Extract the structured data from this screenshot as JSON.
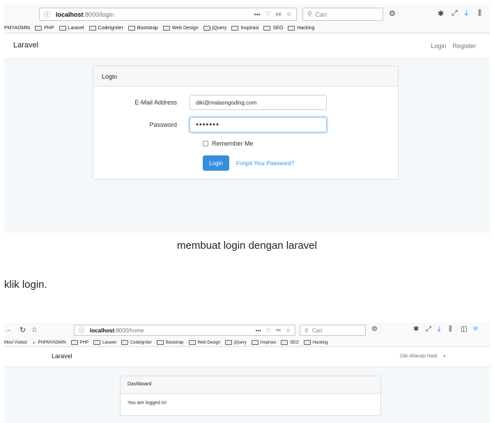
{
  "shot1": {
    "url": {
      "host": "localhost",
      "path": ":8000/login"
    },
    "url_actions": [
      "•••",
      "pocket-icon",
      "pip",
      "star-icon"
    ],
    "search_placeholder": "Cari",
    "bookmarks": [
      "PMYADMIN",
      "PHP",
      "Laravel",
      "CodeIgniter",
      "Bootstrap",
      "Web Design",
      "jQuery",
      "Inspirasi",
      "SEO",
      "Hacking"
    ],
    "navbar": {
      "brand": "Laravel",
      "login": "Login",
      "register": "Register"
    },
    "panel": {
      "heading": "Login",
      "email_label": "E-Mail Address",
      "email_value": "diki@malasngoding.com",
      "password_label": "Password",
      "password_value": "•••••••",
      "remember_label": "Remember Me",
      "login_button": "Login",
      "forgot_link": "Forgot Your Password?"
    }
  },
  "caption": "membuat login dengan laravel",
  "paragraph": "klik login.",
  "shot2": {
    "url": {
      "host": "localhost",
      "path": ":8000/home"
    },
    "url_actions": [
      "•••",
      "pocket-icon",
      "pip",
      "star-icon"
    ],
    "search_placeholder": "Cari",
    "bookmarks": [
      "Most Visited",
      "PHPMYADMIN",
      "PHP",
      "Laravel",
      "CodeIgniter",
      "Bootstrap",
      "Web Design",
      "jQuery",
      "Inspirasi",
      "SEO",
      "Hacking"
    ],
    "navbar": {
      "brand": "Laravel",
      "user": "Diki Alfarabi Hadi"
    },
    "panel": {
      "heading": "Dashboard",
      "body": "You are logged in!"
    }
  }
}
